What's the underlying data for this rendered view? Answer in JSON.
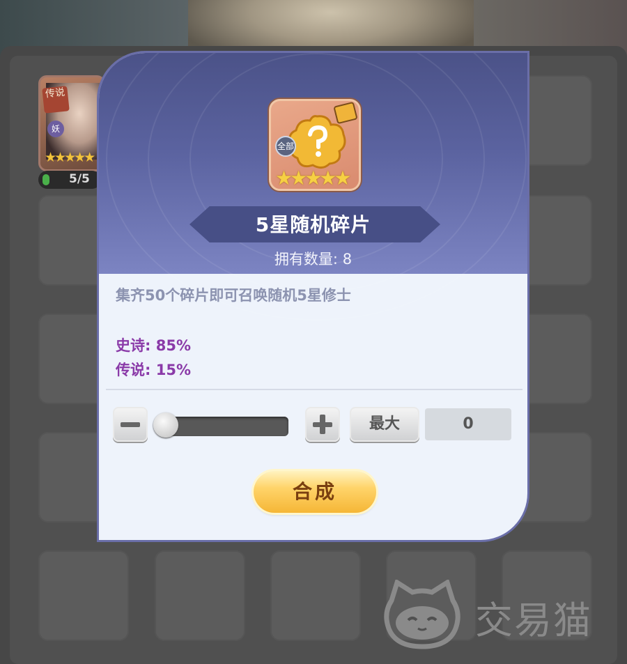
{
  "hero_card": {
    "rarity_badge": "传说",
    "type_badge": "妖",
    "stars": "★★★★★",
    "progress_text": "5/5"
  },
  "watermark": {
    "text": "交易猫"
  },
  "dialog": {
    "item_icon": {
      "badge": "全部",
      "stars": "★★★★★",
      "icon": "random-fragment-icon"
    },
    "title": "5星随机碎片",
    "count_label": "拥有数量:",
    "count_value": "8",
    "description": "集齐50个碎片即可召唤随机5星修士",
    "rates": [
      {
        "label": "史诗:",
        "value": "85%"
      },
      {
        "label": "传说:",
        "value": "15%"
      }
    ],
    "quantity": {
      "slider_value": 0,
      "max_label": "最大",
      "value": "0"
    },
    "craft_label": "合成"
  },
  "colors": {
    "header": "#5b63a0",
    "body": "#eef3fb",
    "rate_text": "#8a3aa8",
    "desc_text": "#8c93b0",
    "craft_button": "#f5b636"
  }
}
